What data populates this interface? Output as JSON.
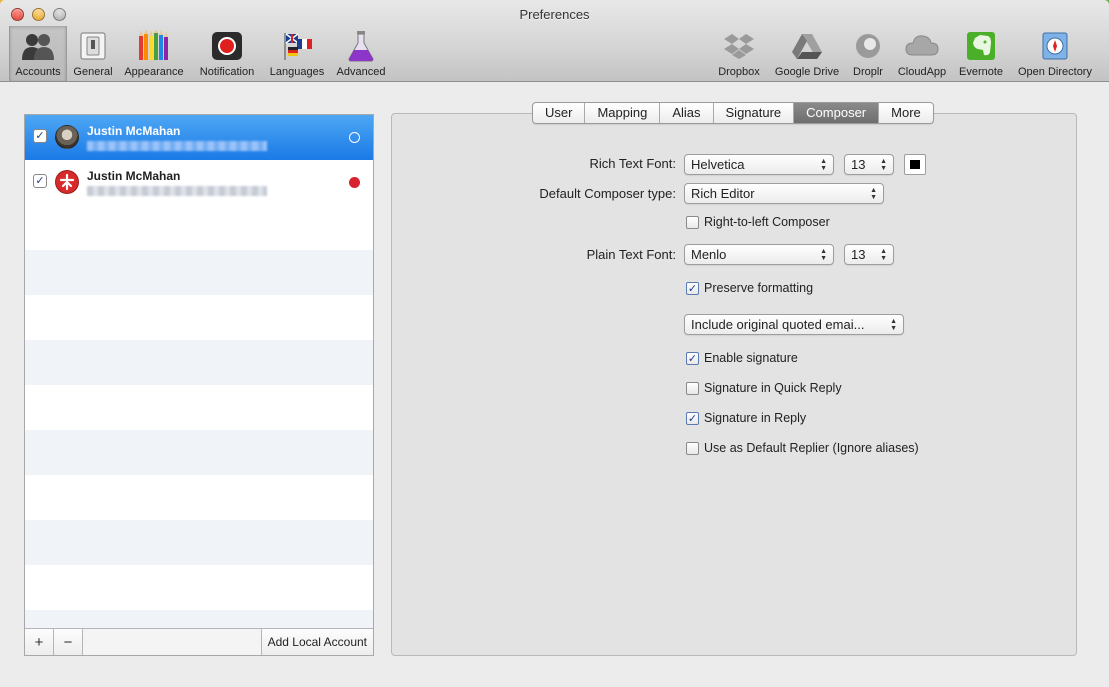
{
  "window": {
    "title": "Preferences"
  },
  "toolbar": {
    "items": [
      {
        "label": "Accounts",
        "icon": "accounts-icon"
      },
      {
        "label": "General",
        "icon": "general-switch-icon"
      },
      {
        "label": "Appearance",
        "icon": "colored-pencils-icon"
      },
      {
        "label": "Notification",
        "icon": "notification-record-icon"
      },
      {
        "label": "Languages",
        "icon": "flags-icon"
      },
      {
        "label": "Advanced",
        "icon": "flask-icon"
      },
      {
        "label": "Dropbox",
        "icon": "dropbox-icon"
      },
      {
        "label": "Google Drive",
        "icon": "google-drive-icon"
      },
      {
        "label": "Droplr",
        "icon": "droplr-icon"
      },
      {
        "label": "CloudApp",
        "icon": "cloud-icon"
      },
      {
        "label": "Evernote",
        "icon": "evernote-icon"
      },
      {
        "label": "Open Directory",
        "icon": "open-directory-icon"
      }
    ],
    "selected": "Accounts"
  },
  "accounts": {
    "list": [
      {
        "name": "Justin McMahan",
        "checked": true,
        "selected": true,
        "avatar": "photo-avatar",
        "status": "open-circle"
      },
      {
        "name": "Justin McMahan",
        "checked": true,
        "selected": false,
        "avatar": "red-logo-avatar",
        "status": "red-dot"
      }
    ],
    "footer": {
      "add_symbol": "+",
      "remove_symbol": "−",
      "add_local_label": "Add Local Account"
    }
  },
  "tabs": {
    "items": [
      "User",
      "Mapping",
      "Alias",
      "Signature",
      "Composer",
      "More"
    ],
    "active": "Composer"
  },
  "composer": {
    "rich_text_font_label": "Rich Text Font:",
    "rich_text_font": "Helvetica",
    "rich_text_size": "13",
    "rich_text_color": "#000000",
    "default_type_label": "Default Composer type:",
    "default_type": "Rich Editor",
    "rtl_label": "Right-to-left Composer",
    "rtl_checked": false,
    "plain_text_font_label": "Plain Text Font:",
    "plain_text_font": "Menlo",
    "plain_text_size": "13",
    "preserve_label": "Preserve formatting",
    "preserve_checked": true,
    "quote_option": "Include original quoted emai...",
    "enable_sig_label": "Enable signature",
    "enable_sig_checked": true,
    "sig_quick_label": "Signature in Quick Reply",
    "sig_quick_checked": false,
    "sig_reply_label": "Signature in Reply",
    "sig_reply_checked": true,
    "default_replier_label": "Use as Default Replier (Ignore aliases)",
    "default_replier_checked": false
  },
  "glyphs": {
    "check": "✓",
    "up": "▲",
    "down": "▼"
  }
}
